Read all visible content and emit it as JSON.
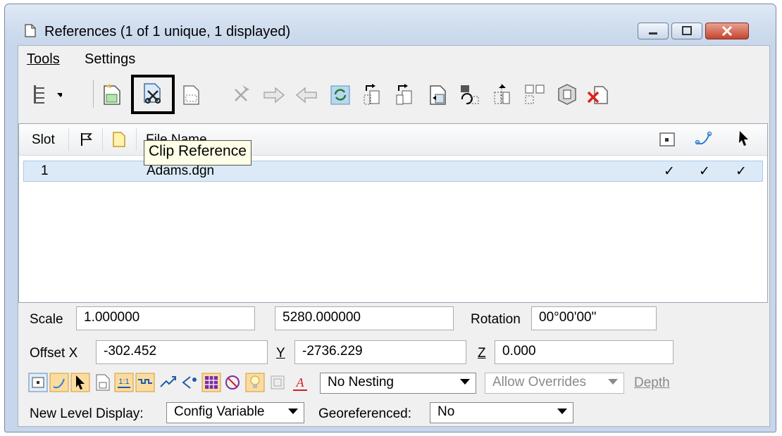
{
  "window": {
    "title": "References (1 of 1 unique, 1 displayed)"
  },
  "menu": {
    "tools": "Tools",
    "settings": "Settings"
  },
  "toolbar": {
    "icons": [
      "hierarchy-display-icon",
      "attach-reference-icon",
      "clip-reference-icon",
      "clip-mask-icon",
      "delete-clip-icon",
      "clip-front-icon",
      "clip-back-icon",
      "reload-reference-icon",
      "move-reference-icon",
      "copy-reference-icon",
      "scale-reference-icon",
      "rotate-reference-icon",
      "mirror-horizontal-icon",
      "mirror-vertical-icon",
      "make-direct-attachment-icon",
      "detach-reference-icon"
    ],
    "tooltip": "Clip Reference"
  },
  "grid": {
    "headers": {
      "slot": "Slot",
      "file_name": "File Name"
    },
    "rows": [
      {
        "slot": "1",
        "file_name": "Adams.dgn",
        "display": "✓",
        "snap": "✓",
        "locate": "✓"
      }
    ]
  },
  "properties": {
    "scale_label": "Scale",
    "scale_value": "1.000000",
    "scale_value2": "5280.000000",
    "rotation_label": "Rotation",
    "rotation_value": "00°00'00\"",
    "offset_x_label": "Offset X",
    "offset_x_value": "-302.452",
    "y_label": "Y",
    "y_value": "-2736.229",
    "z_label": "Z",
    "z_value": "0.000"
  },
  "bottom": {
    "nesting_value": "No Nesting",
    "overrides_value": "Allow Overrides",
    "depth_label": "Depth",
    "new_level_label": "New Level Display:",
    "new_level_value": "Config Variable",
    "georef_label": "Georeferenced:",
    "georef_value": "No"
  },
  "colors": {
    "accent": "#3a78c9",
    "selection": "#dceaf8",
    "close": "#c4452f"
  }
}
